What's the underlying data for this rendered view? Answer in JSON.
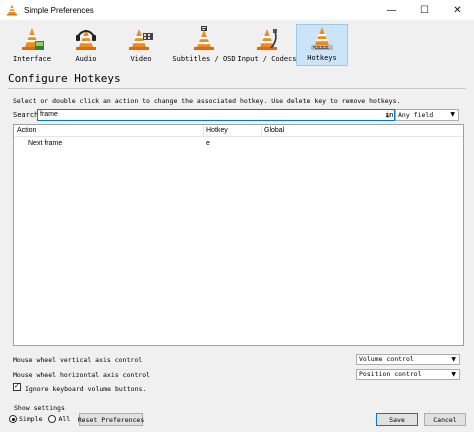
{
  "window": {
    "title": "Simple Preferences",
    "minimize": "—",
    "maximize": "☐",
    "close": "✕"
  },
  "toolbar": [
    {
      "label": "Interface"
    },
    {
      "label": "Audio"
    },
    {
      "label": "Video"
    },
    {
      "label": "Subtitles / OSD"
    },
    {
      "label": "Input / Codecs"
    },
    {
      "label": "Hotkeys"
    }
  ],
  "section_title": "Configure Hotkeys",
  "help_text": "Select or double click an action to change the associated hotkey. Use delete key to remove hotkeys.",
  "search": {
    "label": "Search",
    "value": "frame",
    "in_label": "in",
    "field": "Any field"
  },
  "table": {
    "columns": [
      "Action",
      "Hotkey",
      "Global"
    ],
    "rows": [
      {
        "action": "Next frame",
        "hotkey": "e",
        "global": ""
      }
    ]
  },
  "options": {
    "vertical_label": "Mouse wheel vertical axis control",
    "vertical_value": "Volume control",
    "horizontal_label": "Mouse wheel horizontal axis control",
    "horizontal_value": "Position control",
    "ignore_volume_label": "Ignore keyboard volume buttons.",
    "ignore_volume_checked": true
  },
  "show_settings": {
    "label": "Show settings",
    "simple": "Simple",
    "all": "All"
  },
  "buttons": {
    "reset": "Reset Preferences",
    "save": "Save",
    "cancel": "Cancel"
  },
  "colors": {
    "accent": "#0078d7",
    "cone_orange": "#f08a1c"
  }
}
